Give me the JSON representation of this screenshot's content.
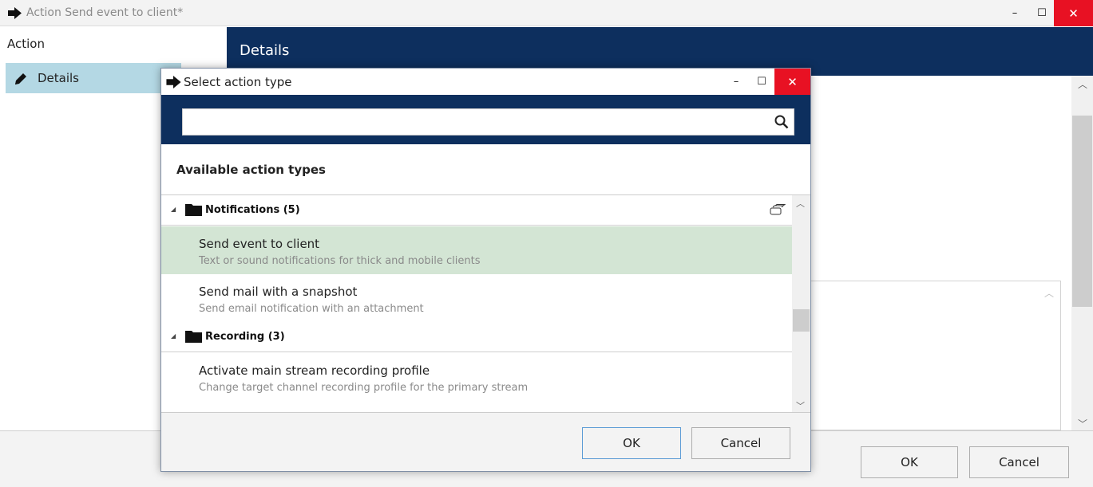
{
  "main_window": {
    "title": "Action Send event to client*",
    "controls": {
      "minimize": "–",
      "maximize": "☐",
      "close": "✕"
    },
    "left_header": "Action",
    "left_items": [
      {
        "label": "Details",
        "icon": "pencil-icon"
      }
    ],
    "details_header": "Details",
    "ok_label": "OK",
    "cancel_label": "Cancel"
  },
  "dialog": {
    "title": "Select action type",
    "controls": {
      "minimize": "–",
      "maximize": "☐",
      "close": "✕"
    },
    "search": {
      "value": "",
      "placeholder": ""
    },
    "available_label": "Available action types",
    "groups": [
      {
        "label": "Notifications (5)",
        "items": [
          {
            "name": "Send event to client",
            "description": "Text or sound notifications for thick and mobile clients",
            "selected": true
          },
          {
            "name": "Send mail with a snapshot",
            "description": "Send email notification with an attachment",
            "selected": false
          }
        ]
      },
      {
        "label": "Recording (3)",
        "items": [
          {
            "name": "Activate main stream recording profile",
            "description": "Change target channel recording profile for the primary stream",
            "selected": false
          }
        ]
      }
    ],
    "ok_label": "OK",
    "cancel_label": "Cancel"
  },
  "colors": {
    "header_navy": "#0d2f5e",
    "selected_row": "#d3e5d4",
    "sidebar_selected": "#b4d8e4",
    "close_red": "#e81123"
  }
}
